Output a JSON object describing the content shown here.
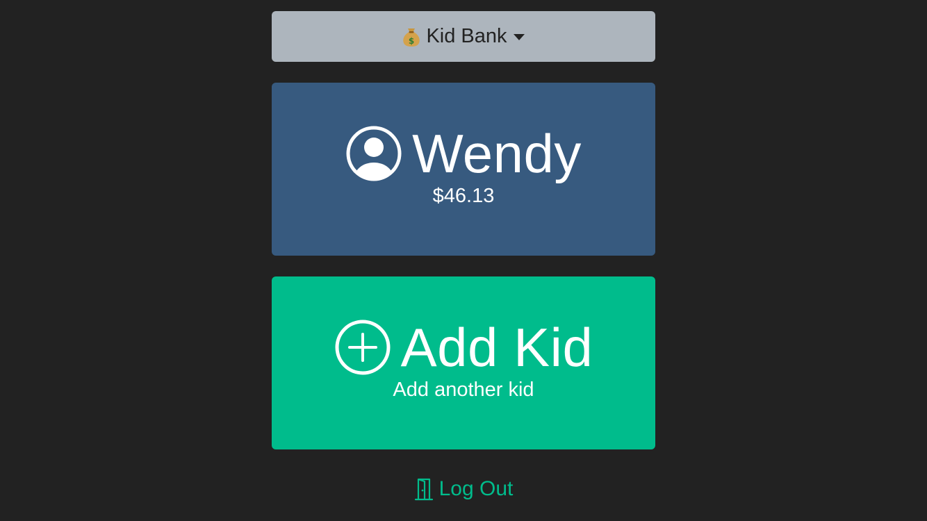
{
  "app": {
    "title": "Kid Bank",
    "title_icon": "money-bag-icon"
  },
  "kids": [
    {
      "name": "Wendy",
      "balance": "$46.13",
      "icon": "user-circle-icon",
      "color": "#375a7f"
    }
  ],
  "add_kid": {
    "title": "Add Kid",
    "subtitle": "Add another kid",
    "icon": "plus-circle-icon",
    "color": "#00bc8c"
  },
  "logout": {
    "label": "Log Out",
    "icon": "door-icon",
    "color": "#00bc8c"
  },
  "colors": {
    "background": "#222222",
    "menu": "#adb5bd"
  }
}
